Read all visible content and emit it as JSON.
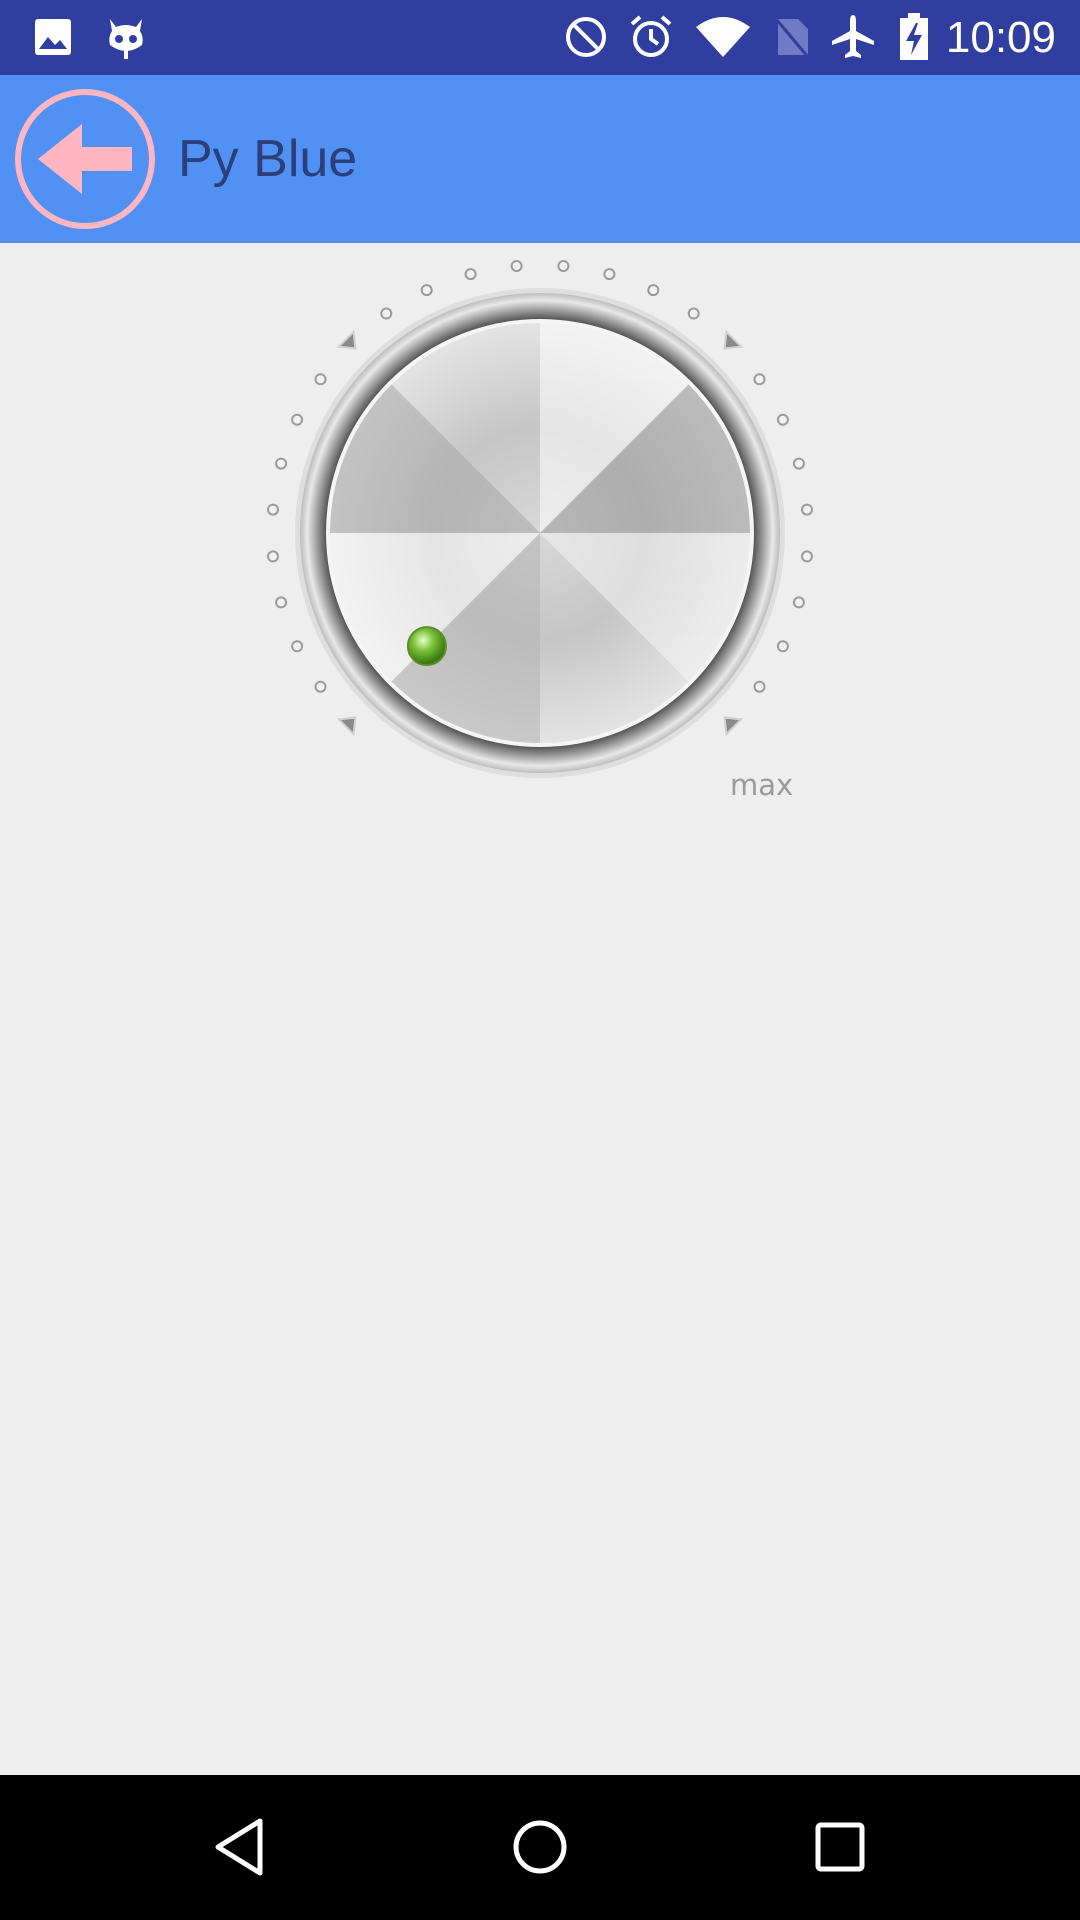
{
  "status_bar": {
    "time": "10:09",
    "left_icons": [
      "image-icon",
      "cyanogen-mascot-icon"
    ],
    "right_icons": [
      "do-not-disturb-icon",
      "alarm-icon",
      "wifi-icon",
      "no-sim-icon",
      "airplane-mode-icon",
      "battery-charging-icon"
    ],
    "background": "#303f9f"
  },
  "app_bar": {
    "title": "Py Blue",
    "back_icon": "back-arrow-icon",
    "background": "#5291f4",
    "title_color": "#2b3f7a",
    "back_icon_color": "#ffb6c1"
  },
  "knob": {
    "max_label": "max",
    "indicator_color": "#7cc43a",
    "level": 0
  },
  "nav_bar": {
    "icons": [
      "nav-back-icon",
      "nav-home-icon",
      "nav-recents-icon"
    ]
  }
}
